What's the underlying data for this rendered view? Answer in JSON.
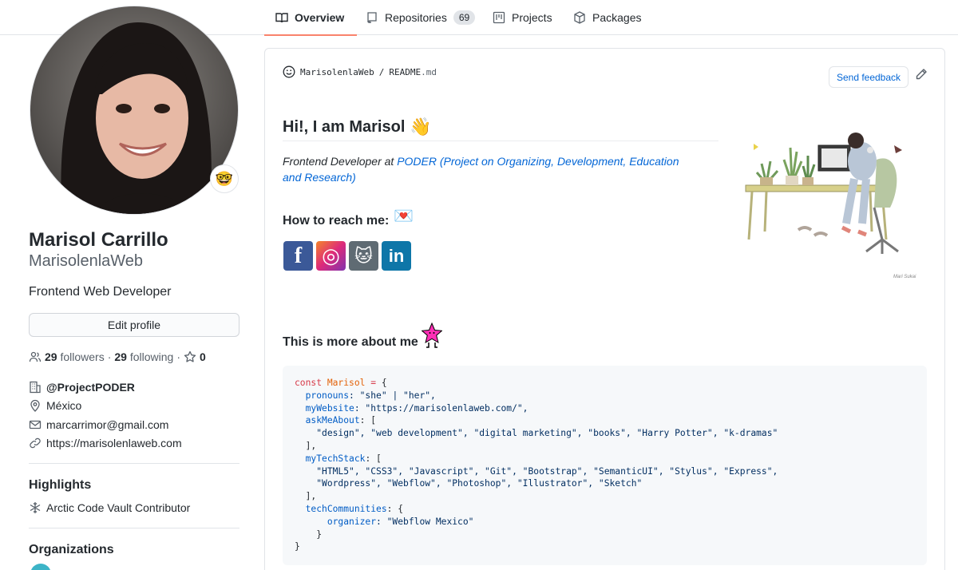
{
  "tabs": [
    {
      "label": "Overview",
      "icon": "book-icon"
    },
    {
      "label": "Repositories",
      "icon": "repo-icon",
      "count": "69"
    },
    {
      "label": "Projects",
      "icon": "project-icon"
    },
    {
      "label": "Packages",
      "icon": "package-icon"
    }
  ],
  "profile": {
    "fullname": "Marisol Carrillo",
    "username": "MarisolenlaWeb",
    "bio": "Frontend Web Developer",
    "edit_label": "Edit profile",
    "followers": "29",
    "followers_label": "followers",
    "following": "29",
    "following_label": "following",
    "stars": "0",
    "company": "@ProjectPODER",
    "location": "México",
    "email": "marcarrimor@gmail.com",
    "website": "https://marisolenlaweb.com",
    "highlights_title": "Highlights",
    "highlight_item": "Arctic Code Vault Contributor",
    "orgs_title": "Organizations",
    "status_emoji": "🤓"
  },
  "readme": {
    "owner": "MarisolenlaWeb",
    "sep": "/",
    "file": "README",
    "ext": ".md",
    "feedback_label": "Send feedback",
    "hi": "Hi!, I am Marisol",
    "hi_emoji": "👋",
    "intro_prefix": "Frontend Developer at ",
    "intro_link": "PODER (Project on Organizing, Development, Education and Research)",
    "reach": "How to reach me:",
    "reach_emoji": "💌",
    "more": "This is more about me",
    "socials": [
      {
        "name": "facebook",
        "glyph": "f",
        "color": "#3b5998"
      },
      {
        "name": "instagram",
        "glyph": "◎",
        "color": "#e1306c"
      },
      {
        "name": "github",
        "glyph": "🐱",
        "color": "#5f6b73"
      },
      {
        "name": "linkedin",
        "glyph": "in",
        "color": "#0e76a8"
      }
    ]
  },
  "code": {
    "l1_kw": "const",
    "l1_var": "Marisol",
    "l1_rest": " = {",
    "pronouns_key": "pronouns",
    "pronouns_val": ": \"she\" | \"her\",",
    "site_key": "myWebsite",
    "site_val": ": \"https://marisolenlaweb.com/\",",
    "ask_key": "askMeAbout",
    "ask_open": ": [",
    "ask_items": "\"design\", \"web development\", \"digital marketing\", \"books\", \"Harry Potter\", \"k-dramas\"",
    "close_arr": "],",
    "stack_key": "myTechStack",
    "stack_open": ": [",
    "stack_items1": "\"HTML5\", \"CSS3\", \"Javascript\", \"Git\", \"Bootstrap\", \"SemanticUI\", \"Stylus\", \"Express\",",
    "stack_items2": "\"Wordpress\", \"Webflow\", \"Photoshop\", \"Illustrator\", \"Sketch\"",
    "close_arr2": "],",
    "comm_key": "techCommunities",
    "comm_open": ": {",
    "org_key": "organizer",
    "org_val": ": \"Webflow Mexico\"",
    "close_obj": "}",
    "close_main": "}"
  }
}
